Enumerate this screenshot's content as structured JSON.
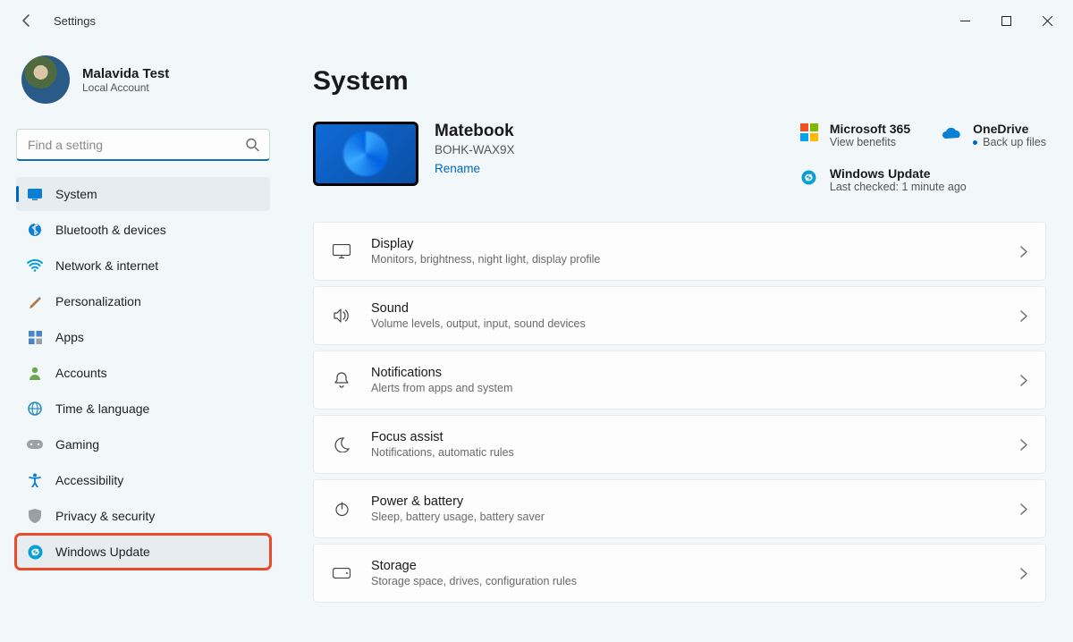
{
  "window": {
    "title": "Settings"
  },
  "profile": {
    "name": "Malavida Test",
    "account_type": "Local Account"
  },
  "search": {
    "placeholder": "Find a setting"
  },
  "sidebar": {
    "items": [
      {
        "label": "System",
        "icon": "system"
      },
      {
        "label": "Bluetooth & devices",
        "icon": "bluetooth"
      },
      {
        "label": "Network & internet",
        "icon": "wifi"
      },
      {
        "label": "Personalization",
        "icon": "brush"
      },
      {
        "label": "Apps",
        "icon": "apps"
      },
      {
        "label": "Accounts",
        "icon": "person"
      },
      {
        "label": "Time & language",
        "icon": "globe"
      },
      {
        "label": "Gaming",
        "icon": "gamepad"
      },
      {
        "label": "Accessibility",
        "icon": "accessibility"
      },
      {
        "label": "Privacy & security",
        "icon": "shield"
      },
      {
        "label": "Windows Update",
        "icon": "update"
      }
    ],
    "active_index": 0,
    "highlight_index": 10
  },
  "main": {
    "heading": "System",
    "device": {
      "name": "Matebook",
      "model": "BOHK-WAX9X",
      "rename_label": "Rename"
    },
    "promo_tiles": [
      {
        "title": "Microsoft 365",
        "sub": "View benefits",
        "icon": "microsoft"
      },
      {
        "title": "OneDrive",
        "sub": "Back up files",
        "icon": "onedrive",
        "bullet": true
      },
      {
        "title": "Windows Update",
        "sub": "Last checked: 1 minute ago",
        "icon": "update",
        "span": true
      }
    ],
    "cards": [
      {
        "title": "Display",
        "sub": "Monitors, brightness, night light, display profile",
        "icon": "display"
      },
      {
        "title": "Sound",
        "sub": "Volume levels, output, input, sound devices",
        "icon": "sound"
      },
      {
        "title": "Notifications",
        "sub": "Alerts from apps and system",
        "icon": "bell"
      },
      {
        "title": "Focus assist",
        "sub": "Notifications, automatic rules",
        "icon": "moon"
      },
      {
        "title": "Power & battery",
        "sub": "Sleep, battery usage, battery saver",
        "icon": "power"
      },
      {
        "title": "Storage",
        "sub": "Storage space, drives, configuration rules",
        "icon": "storage"
      }
    ]
  }
}
